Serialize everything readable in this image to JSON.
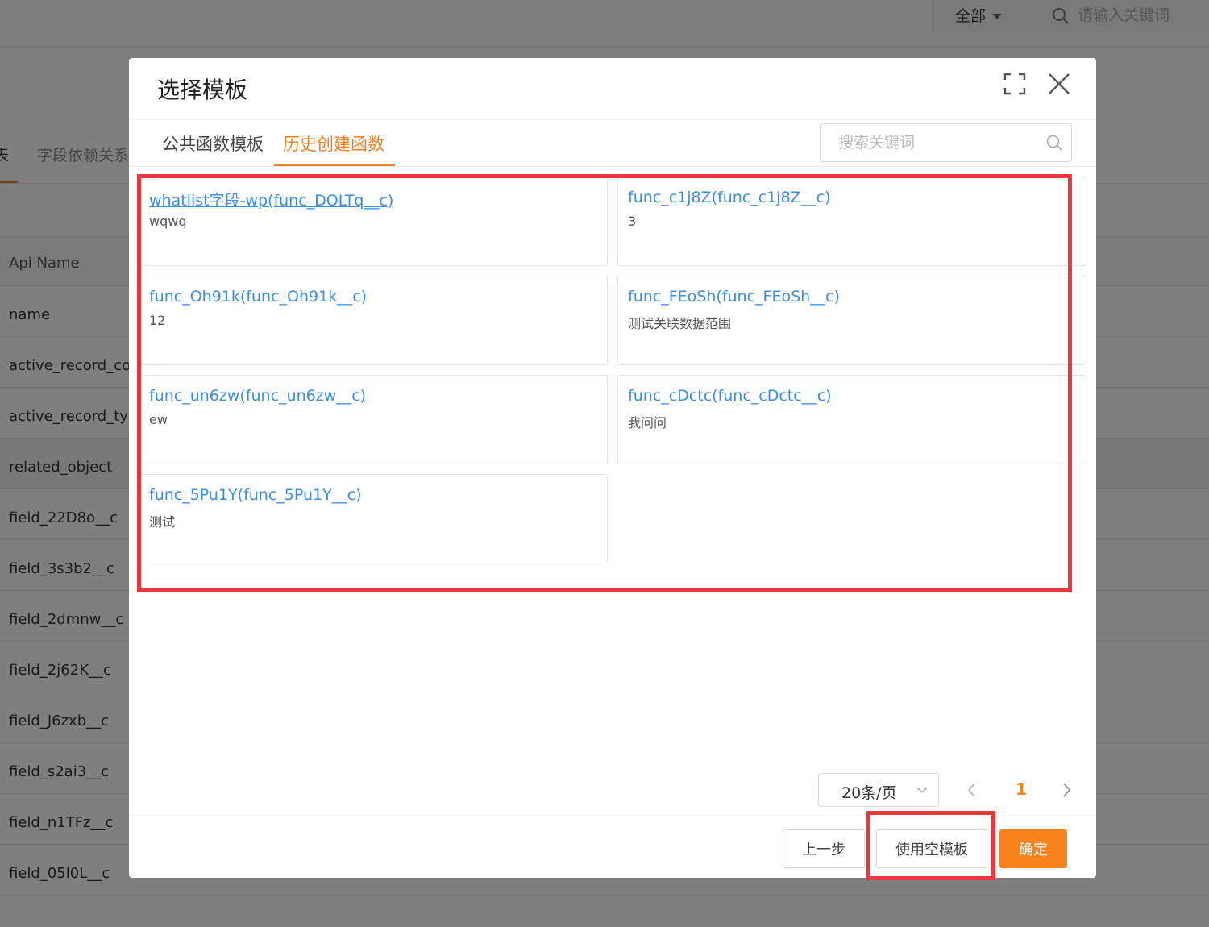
{
  "background": {
    "filter": {
      "selected": "全部",
      "search_placeholder": "请输入关键词"
    },
    "tabs": [
      "表",
      "字段依赖关系"
    ],
    "table": {
      "header": "Api Name",
      "rows": [
        "name",
        "active_record_cont",
        "active_record_type",
        "related_object",
        "field_22D8o__c",
        "field_3s3b2__c",
        "field_2dmnw__c",
        "field_2j62K__c",
        "field_J6zxb__c",
        "field_s2ai3__c",
        "field_n1TFz__c",
        "field_05l0L__c"
      ]
    }
  },
  "modal": {
    "title": "选择模板",
    "tabs": [
      {
        "label": "公共函数模板",
        "active": false
      },
      {
        "label": "历史创建函数",
        "active": true
      }
    ],
    "search": {
      "placeholder": "搜索关键词",
      "value": ""
    },
    "cards": [
      {
        "title": "whatlist字段-wp(func_DOLTq__c)",
        "desc": "wqwq"
      },
      {
        "title": "func_c1j8Z(func_c1j8Z__c)",
        "desc": "3"
      },
      {
        "title": "func_Oh91k(func_Oh91k__c)",
        "desc": "12"
      },
      {
        "title": "func_FEoSh(func_FEoSh__c)",
        "desc": "测试关联数据范围"
      },
      {
        "title": "func_un6zw(func_un6zw__c)",
        "desc": "ew"
      },
      {
        "title": "func_cDctc(func_cDctc__c)",
        "desc": "我问问"
      },
      {
        "title": "func_5Pu1Y(func_5Pu1Y__c)",
        "desc": "测试"
      }
    ],
    "pagination": {
      "page_size": "20条/页",
      "current_page": "1"
    },
    "footer": {
      "prev_label": "上一步",
      "empty_template_label": "使用空模板",
      "confirm_label": "确定"
    }
  },
  "colors": {
    "accent": "#f08321",
    "link": "#3a8ee6",
    "highlight": "#e8383d",
    "primary_button": "#f8821c"
  }
}
